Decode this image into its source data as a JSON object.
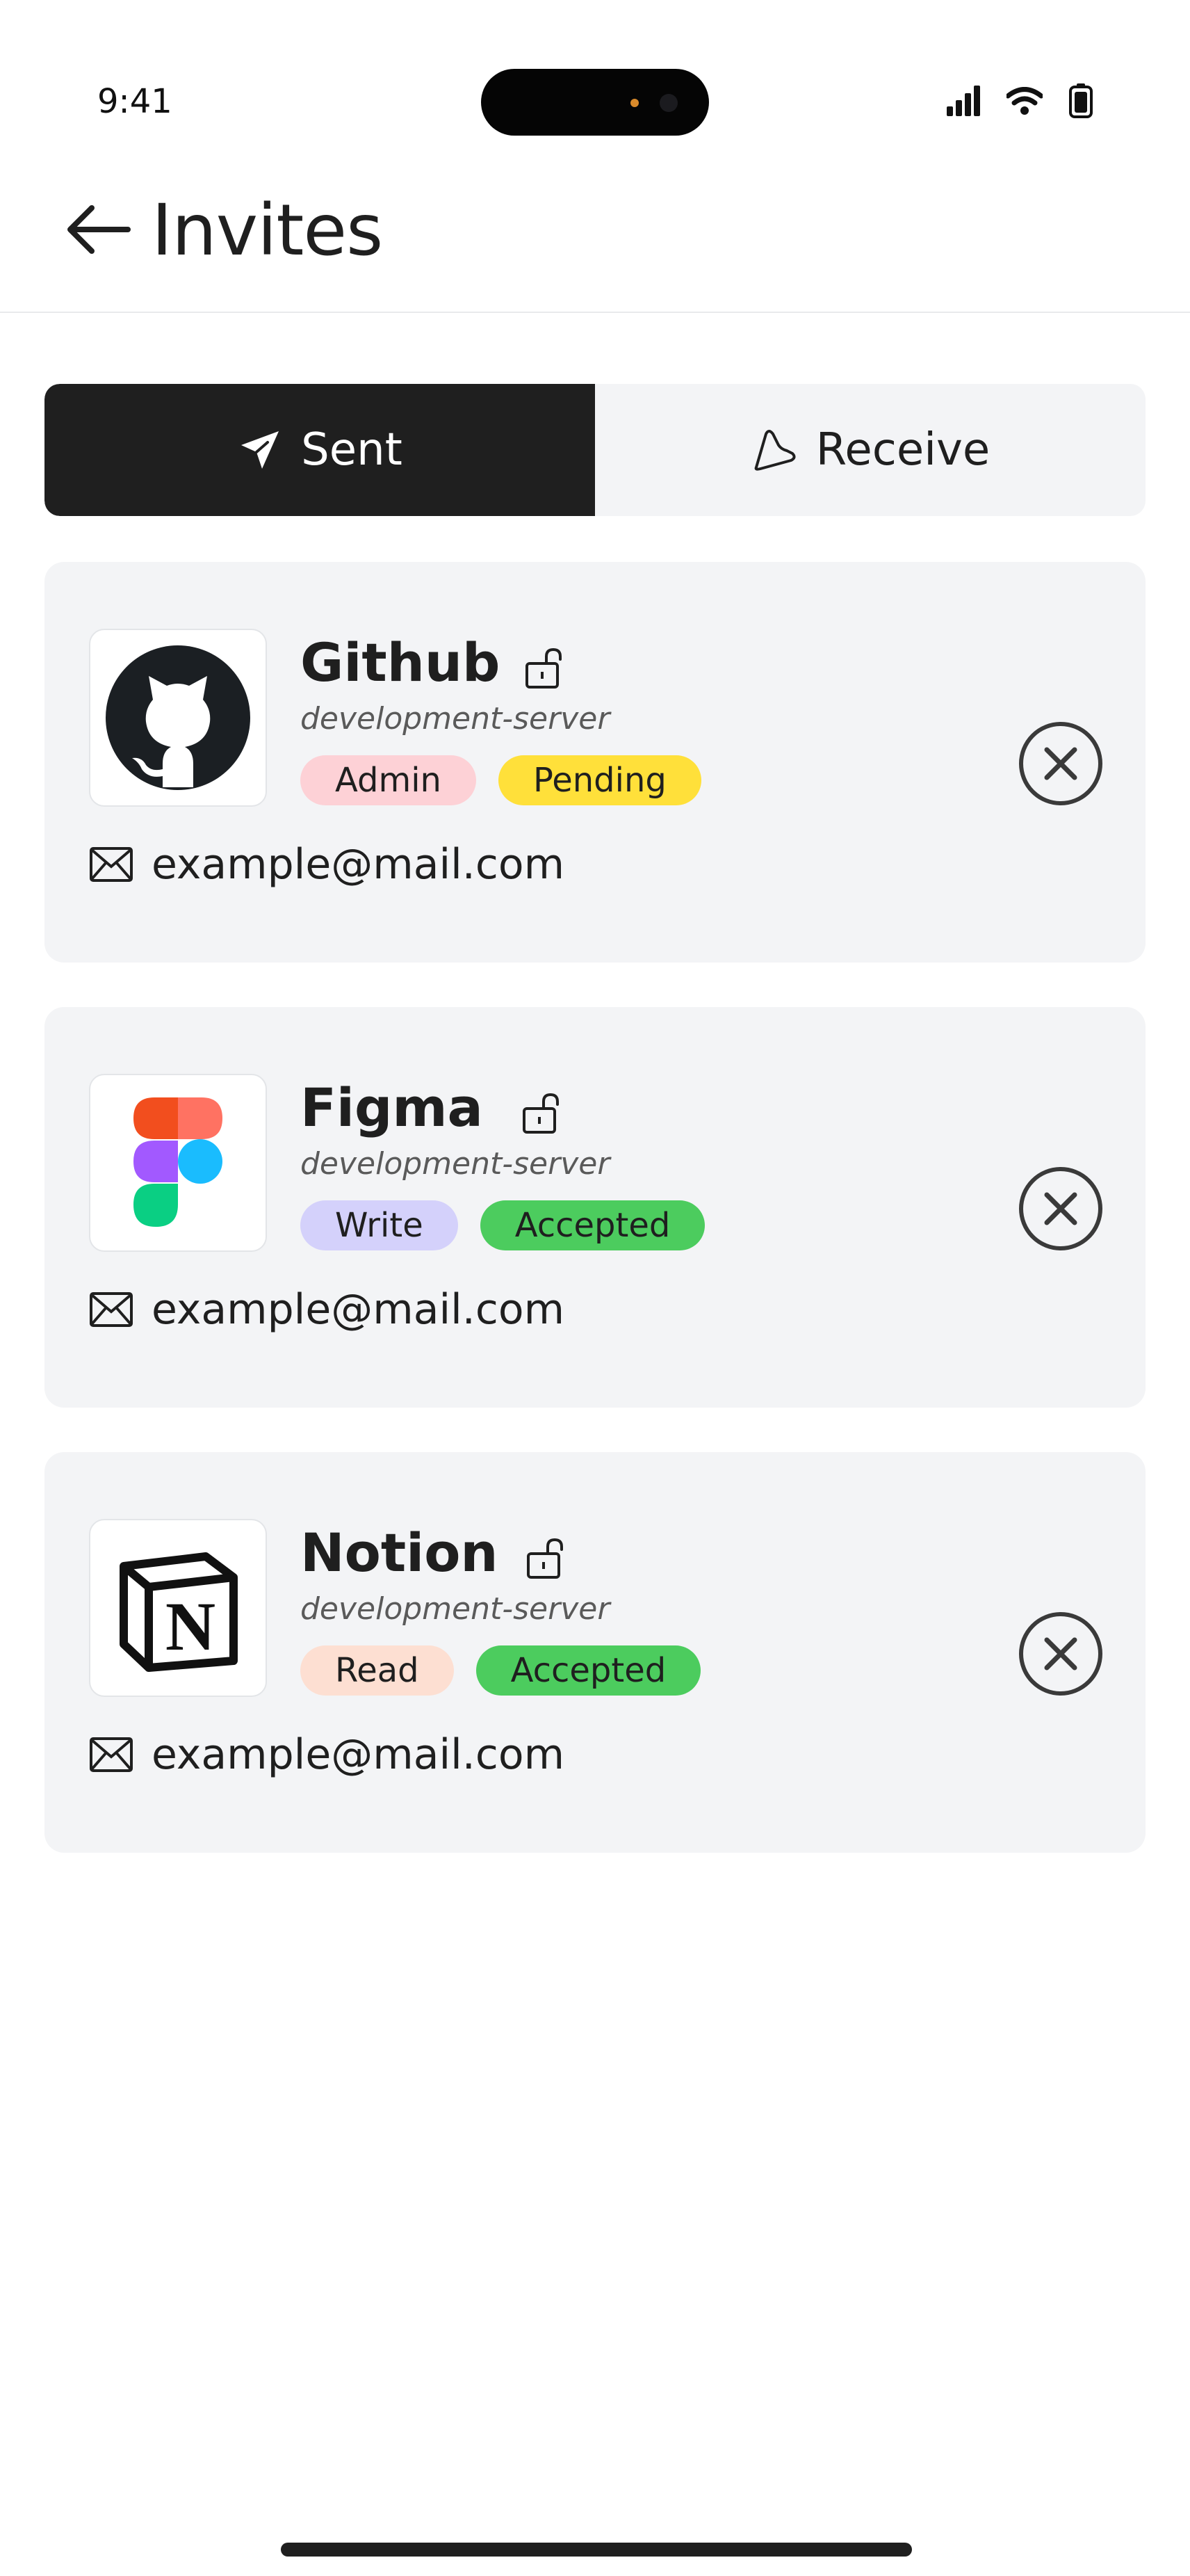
{
  "status_bar": {
    "time": "9:41"
  },
  "header": {
    "title": "Invites"
  },
  "tabs": [
    {
      "label": "Sent",
      "active": true
    },
    {
      "label": "Receive",
      "active": false
    }
  ],
  "colors": {
    "active_tab": "#1f1f1f",
    "card_bg": "#f3f4f6",
    "badge_admin": "#fdd1d6",
    "badge_pending": "#ffe03a",
    "badge_write": "#d4d1fb",
    "badge_accepted": "#4ccc5e",
    "badge_read": "#fddfd2"
  },
  "invites": [
    {
      "app": "Github",
      "icon": "github-logo-icon",
      "server": "development-server",
      "role": "Admin",
      "status": "Pending",
      "email": "example@mail.com"
    },
    {
      "app": "Figma",
      "icon": "figma-logo-icon",
      "server": "development-server",
      "role": "Write",
      "status": "Accepted",
      "email": "example@mail.com"
    },
    {
      "app": "Notion",
      "icon": "notion-logo-icon",
      "server": "development-server",
      "role": "Read",
      "status": "Accepted",
      "email": "example@mail.com"
    }
  ]
}
